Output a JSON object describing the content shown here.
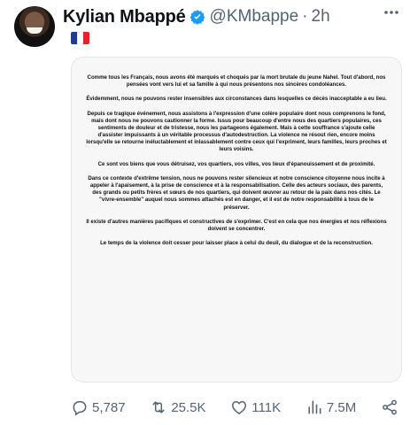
{
  "author": {
    "name": "Kylian Mbappé",
    "handle": "@KMbappe",
    "separator": "·",
    "time": "2h",
    "flag_colors": [
      "#1f3c96",
      "#ffffff",
      "#e1232a"
    ]
  },
  "icons": {
    "verified": "verified-badge-icon",
    "more": "more-options-icon",
    "reply": "reply-icon",
    "retweet": "retweet-icon",
    "like": "like-icon",
    "views": "views-icon",
    "share": "share-icon"
  },
  "statement": {
    "paragraphs": [
      "Comme tous les Français, nous avons été marqués et choqués par la mort brutale du jeune Nahel. Tout d'abord, nos pensées vont vers lui et sa famille à qui nous présentons nos sincères condoléances.",
      "Évidemment, nous ne pouvons rester insensibles aux circonstances dans lesquelles ce décès inacceptable a eu lieu.",
      "Depuis ce tragique événement, nous assistons à l'expression d'une colère populaire dont nous comprenons le fond, mais dont nous ne pouvons cautionner la forme. Issus pour beaucoup d'entre nous des quartiers populaires, ces sentiments de douleur et de tristesse, nous les partageons également. Mais à cette souffrance s'ajoute celle d'assister impuissants à un véritable processus d'autodestruction. La violence ne résout rien, encore moins lorsqu'elle se retourne inéluctablement et inlassablement contre ceux qui l'expriment, leurs familles, leurs proches et leurs voisins.",
      "Ce sont vos biens que vous détruisez, vos quartiers, vos villes, vos lieux d'épanouissement et de proximité.",
      "Dans ce contexte d'extrême tension, nous ne pouvons rester silencieux et notre conscience citoyenne nous incite à appeler à l'apaisement, à la prise de conscience et à la responsabilisation. Celle des acteurs sociaux, des parents, des grands ou petits frères et sœurs de nos quartiers, qui doivent œuvrer au retour de la paix dans nos cités. Le \"vivre-ensemble\" auquel nous sommes attachés est en danger, et il est de notre responsabilité à tous de le préserver.",
      "Il existe d'autres manières pacifiques et constructives de s'exprimer. C'est en cela que nos énergies et nos réflexions doivent se concentrer.",
      "Le temps de la violence doit cesser pour laisser place à celui du deuil, du dialogue et de la reconstruction."
    ]
  },
  "metrics": {
    "replies": "5,787",
    "retweets": "25.5K",
    "likes": "111K",
    "views": "7.5M"
  },
  "colors": {
    "verified": "#1d9bf0",
    "muted": "#536471",
    "text": "#0f1419"
  }
}
